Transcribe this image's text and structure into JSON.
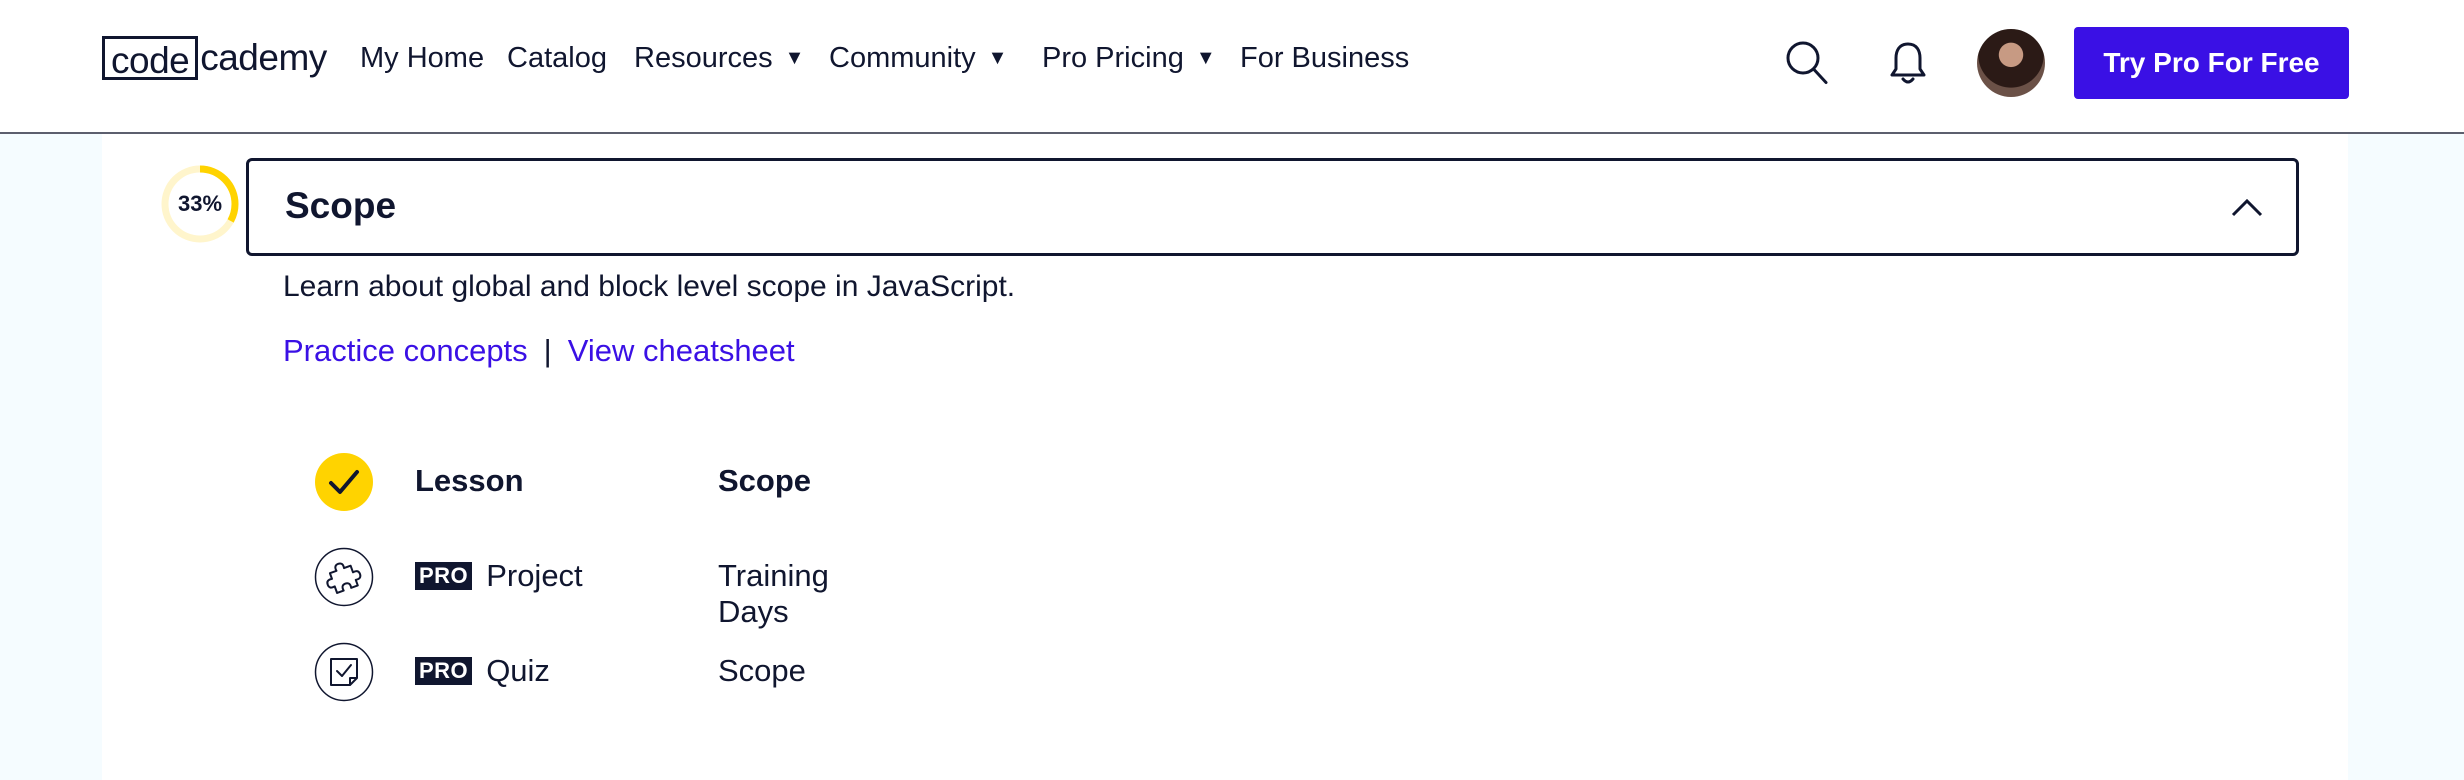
{
  "brand": {
    "logo_boxed": "code",
    "logo_rest": "cademy"
  },
  "nav": [
    {
      "label": "My Home",
      "caret": false
    },
    {
      "label": "Catalog",
      "caret": false
    },
    {
      "label": "Resources",
      "caret": true
    },
    {
      "label": "Community",
      "caret": true
    },
    {
      "label": "Pro Pricing",
      "caret": true
    },
    {
      "label": "For Business",
      "caret": false
    }
  ],
  "header_icons": [
    "search-icon",
    "bell-icon"
  ],
  "cta_label": "Try Pro For Free",
  "colors": {
    "accent": "#3a10e5",
    "navy": "#10162f",
    "progress": "#ffd300",
    "check_bg": "#ffd300"
  },
  "module": {
    "progress_percent": 33,
    "progress_label": "33%",
    "title": "Scope",
    "description": "Learn about global and block level scope in JavaScript.",
    "links": {
      "practice": "Practice concepts",
      "separator": "|",
      "cheatsheet": "View cheatsheet"
    },
    "items": [
      {
        "icon": "check-icon",
        "type": "Lesson",
        "pro": false,
        "title": "Scope",
        "completed": true
      },
      {
        "icon": "puzzle-icon",
        "type": "Project",
        "pro": true,
        "pro_label": "PRO",
        "title": "Training Days",
        "completed": false
      },
      {
        "icon": "quiz-note-icon",
        "type": "Quiz",
        "pro": true,
        "pro_label": "PRO",
        "title": "Scope",
        "completed": false
      }
    ]
  }
}
